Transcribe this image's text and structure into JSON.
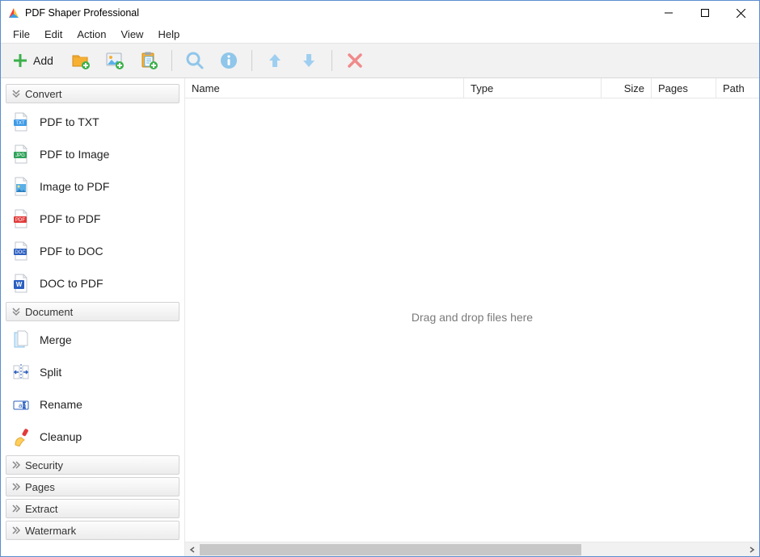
{
  "window": {
    "title": "PDF Shaper Professional"
  },
  "menu": {
    "file": "File",
    "edit": "Edit",
    "action": "Action",
    "view": "View",
    "help": "Help"
  },
  "toolbar": {
    "add_label": "Add"
  },
  "sidebar": {
    "categories": {
      "convert": {
        "label": "Convert",
        "items": [
          {
            "label": "PDF to TXT",
            "icon": "txt-icon"
          },
          {
            "label": "PDF to Image",
            "icon": "jpg-icon"
          },
          {
            "label": "Image to PDF",
            "icon": "image-icon"
          },
          {
            "label": "PDF to PDF",
            "icon": "pdf-icon"
          },
          {
            "label": "PDF to DOC",
            "icon": "doc-icon"
          },
          {
            "label": "DOC to PDF",
            "icon": "word-icon"
          }
        ]
      },
      "document": {
        "label": "Document",
        "items": [
          {
            "label": "Merge",
            "icon": "merge-icon"
          },
          {
            "label": "Split",
            "icon": "split-icon"
          },
          {
            "label": "Rename",
            "icon": "rename-icon"
          },
          {
            "label": "Cleanup",
            "icon": "cleanup-icon"
          }
        ]
      },
      "security": {
        "label": "Security"
      },
      "pages": {
        "label": "Pages"
      },
      "extract": {
        "label": "Extract"
      },
      "watermark": {
        "label": "Watermark"
      }
    }
  },
  "columns": {
    "name": "Name",
    "type": "Type",
    "size": "Size",
    "pages": "Pages",
    "path": "Path"
  },
  "file_area": {
    "placeholder": "Drag and drop files here"
  }
}
